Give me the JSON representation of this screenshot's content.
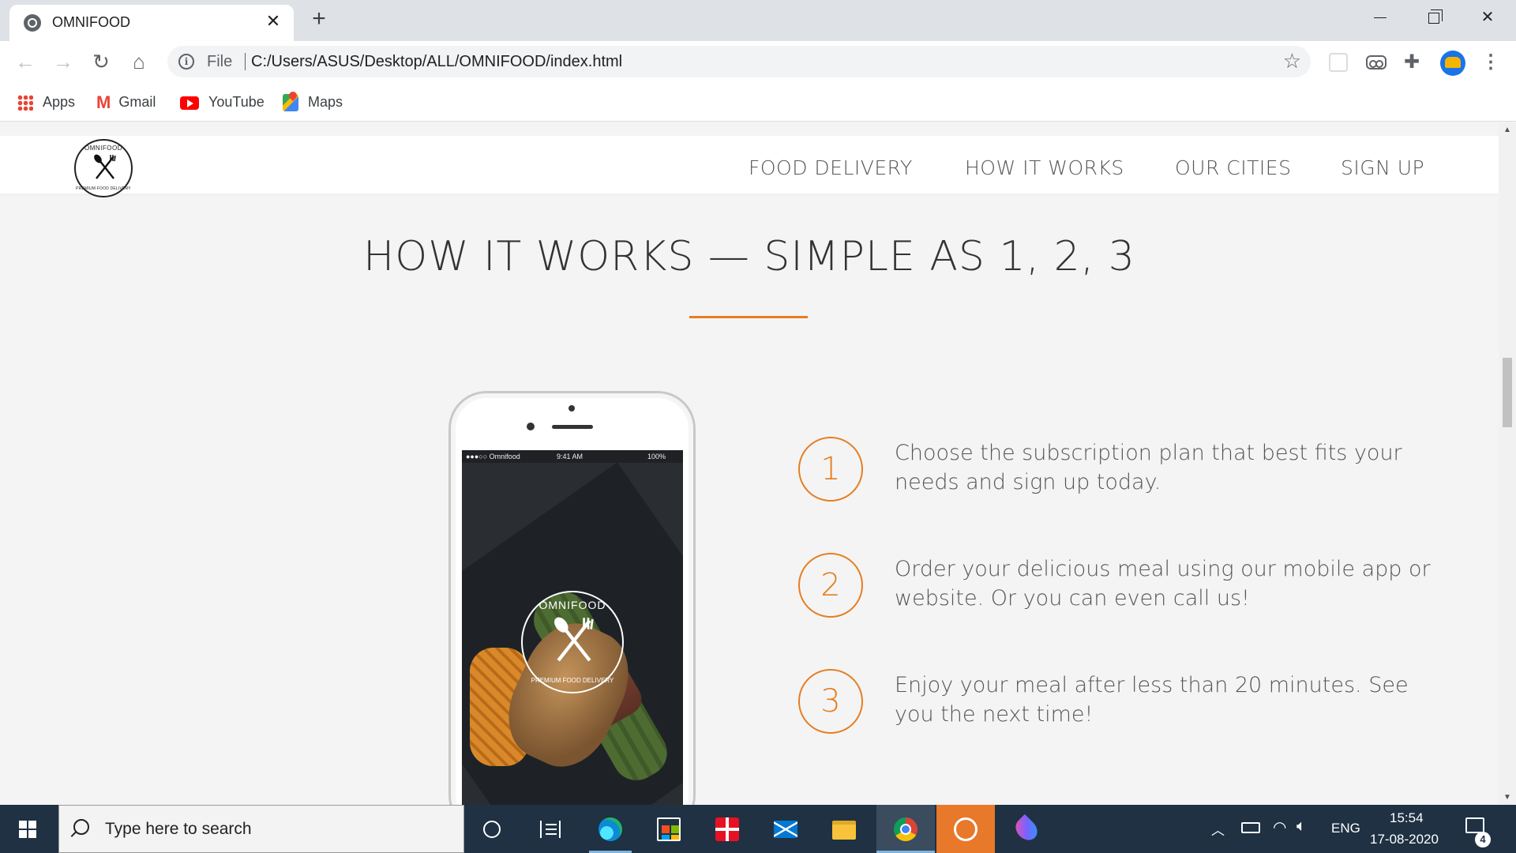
{
  "browser": {
    "tab_title": "OMNIFOOD",
    "tab_close": "✕",
    "new_tab": "+",
    "omnibox_scheme": "File",
    "omnibox_url": "C:/Users/ASUS/Desktop/ALL/OMNIFOOD/index.html"
  },
  "bookmarks": [
    {
      "label": "Apps",
      "icon": "apps-grid-icon"
    },
    {
      "label": "Gmail",
      "icon": "gmail-icon"
    },
    {
      "label": "YouTube",
      "icon": "youtube-icon"
    },
    {
      "label": "Maps",
      "icon": "maps-icon"
    }
  ],
  "site": {
    "logo_top": "OMNIFOOD",
    "logo_bottom": "PREMIUM FOOD DELIVERY",
    "nav": [
      "FOOD DELIVERY",
      "HOW IT WORKS",
      "OUR CITIES",
      "SIGN UP"
    ],
    "section_title": "HOW IT WORKS — SIMPLE AS 1, 2, 3",
    "accent_color": "#e67e22",
    "phone_status": {
      "carrier": "●●●○○ Omnifood",
      "time": "9:41 AM",
      "battery": "100%"
    },
    "steps": [
      {
        "num": "1",
        "text": "Choose the subscription plan that best fits your needs and sign up today."
      },
      {
        "num": "2",
        "text": "Order your delicious meal using our mobile app or website. Or you can even call us!"
      },
      {
        "num": "3",
        "text": "Enjoy your meal after less than 20 minutes. See you the next time!"
      }
    ]
  },
  "taskbar": {
    "search_placeholder": "Type here to search",
    "language": "ENG",
    "time": "15:54",
    "date": "17-08-2020",
    "notification_count": "4"
  }
}
